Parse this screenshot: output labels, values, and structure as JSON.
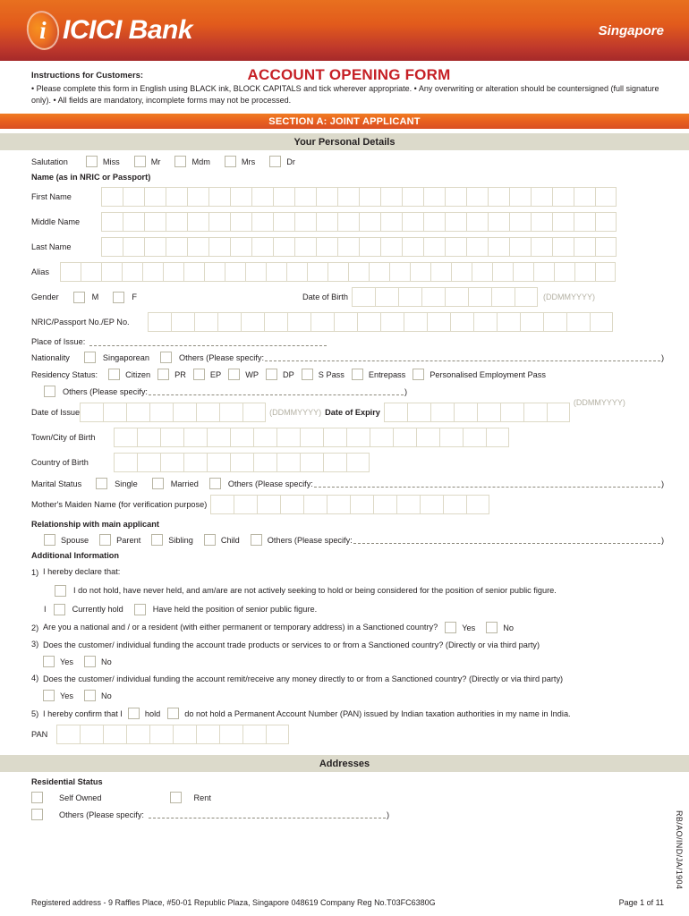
{
  "header": {
    "bank_name": "ICICI Bank",
    "logo_letter": "i",
    "region": "Singapore"
  },
  "title": {
    "form_title": "ACCOUNT OPENING FORM",
    "instructions_heading": "Instructions for Customers:",
    "instructions_body": "• Please complete this form in English using BLACK ink, BLOCK CAPITALS and tick wherever appropriate. • Any overwriting or alteration should be countersigned (full signature only). • All fields are mandatory, incomplete forms may not be processed."
  },
  "section_banner": "SECTION A: JOINT APPLICANT",
  "personal_details": {
    "heading": "Your Personal Details",
    "salutation_label": "Salutation",
    "salutation_options": [
      "Miss",
      "Mr",
      "Mdm",
      "Mrs",
      "Dr"
    ],
    "name_heading": "Name (as in NRIC or Passport)",
    "first_name_label": "First Name",
    "middle_name_label": "Middle Name",
    "last_name_label": "Last Name",
    "alias_label": "Alias",
    "gender_label": "Gender",
    "gender_options": [
      "M",
      "F"
    ],
    "dob_label": "Date of Birth",
    "date_hint": "(DDMMYYYY)",
    "nric_label": "NRIC/Passport No./EP No.",
    "place_of_issue_label": "Place of Issue:",
    "nationality_label": "Nationality",
    "nationality_option": "Singaporean",
    "others_specify": "Others (Please specify:",
    "others_close": ")",
    "residency_label": "Residency Status:",
    "residency_options": [
      "Citizen",
      "PR",
      "EP",
      "WP",
      "DP",
      "S Pass",
      "Entrepass",
      "Personalised Employment Pass"
    ],
    "doi_label": "Date of Issue",
    "doe_label": "Date of Expiry",
    "town_label": "Town/City of Birth",
    "country_label": "Country of Birth",
    "marital_label": "Marital Status",
    "marital_options": [
      "Single",
      "Married"
    ],
    "mother_label": "Mother's Maiden Name (for verification purpose)",
    "relationship_heading": "Relationship with main applicant",
    "relationship_options": [
      "Spouse",
      "Parent",
      "Sibling",
      "Child"
    ],
    "box_counts": {
      "first_name": 24,
      "middle_name": 24,
      "last_name": 24,
      "alias": 27,
      "dob": 8,
      "nric": 20,
      "date_issue": 8,
      "date_expiry": 8,
      "town": 17,
      "country": 11,
      "mother": 12,
      "pan": 10
    }
  },
  "additional_info": {
    "heading": "Additional Information",
    "q1_num": "1)",
    "q1_text": "I hereby declare that:",
    "q1_opt1": "I do not hold, have never held, and am/are are not actively seeking to hold or being considered for the position of senior public figure.",
    "q1_prefix": "I",
    "q1_opt2": "Currently hold",
    "q1_opt3": "Have held the position of senior public figure.",
    "q2_num": "2)",
    "q2_text": "Are you a national and / or a resident (with either permanent or temporary address) in a  Sanctioned country?",
    "q3_num": "3)",
    "q3_text": "Does the customer/ individual funding the account trade products or services to or from a Sanctioned country? (Directly or via third party)",
    "q4_num": "4)",
    "q4_text": "Does the customer/ individual funding the account remit/receive any money directly to or from a Sanctioned country? (Directly or via third party)",
    "q5_num": "5)",
    "q5_text_a": "I hereby confirm that I",
    "q5_opt1": "hold",
    "q5_opt2": "do not hold a Permanent Account Number (PAN) issued by Indian taxation authorities in my name in India.",
    "yes_label": "Yes",
    "no_label": "No",
    "pan_label": "PAN"
  },
  "addresses": {
    "heading": "Addresses",
    "residential_status_label": "Residential Status",
    "self_owned": "Self Owned",
    "rent": "Rent",
    "others_specify": "Others (Please specify:",
    "others_close": ")"
  },
  "footer": {
    "registered_address": "Registered address - 9 Raffles Place, #50-01 Republic Plaza, Singapore 048619 Company Reg No.T03FC6380G",
    "page_number": "Page 1 of 11",
    "doc_code": "RB/AO/IND/JA/1904"
  },
  "colors": {
    "header_orange": "#e8701f",
    "header_red": "#a52a2a",
    "title_red": "#c62026",
    "banner_orange": "#e8601f",
    "sub_banner_beige": "#dcdacb",
    "box_border": "#ddd9c6"
  }
}
